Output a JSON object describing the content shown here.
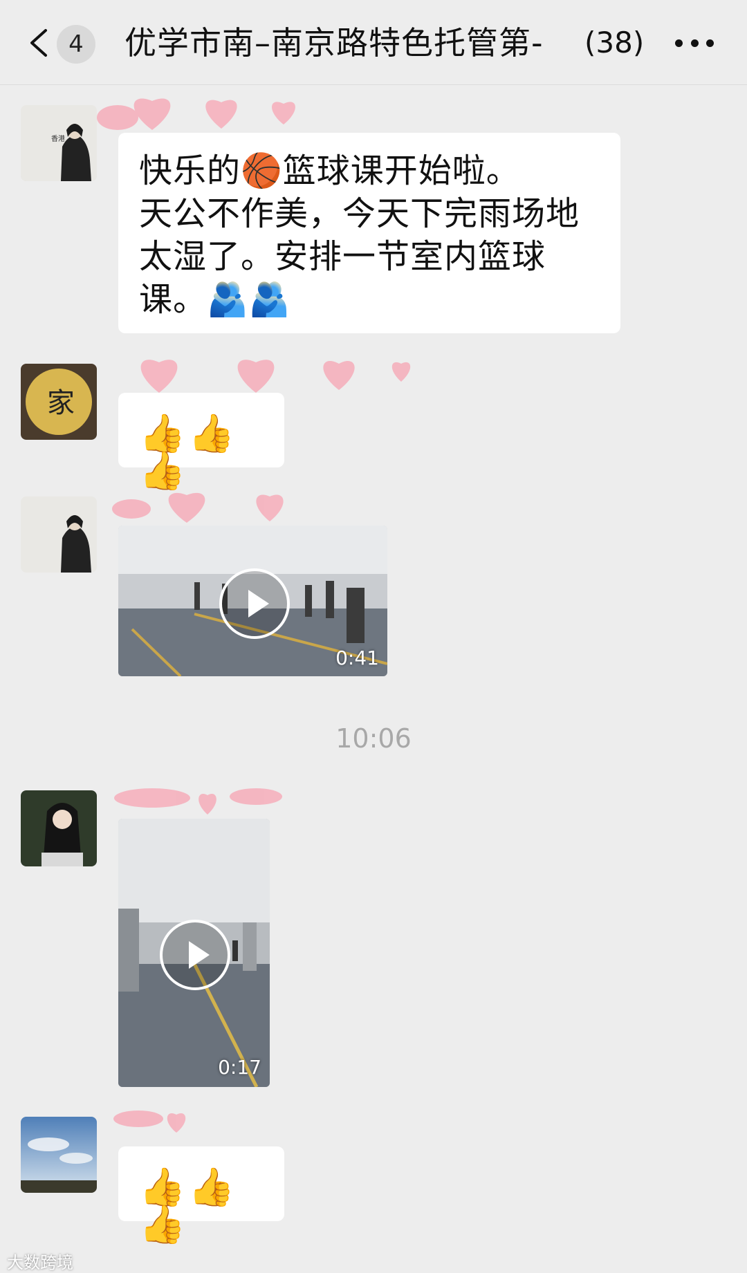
{
  "header": {
    "unread_count": "4",
    "title": "优学市南–南京路特色托管第-",
    "member_count": "(38)"
  },
  "messages": [
    {
      "type": "text",
      "text": "快乐的🏀篮球课开始啦。\n天公不作美，今天下完雨场地\n太湿了。安排一节室内篮球\n课。🫂🫂"
    },
    {
      "type": "emoji",
      "text": "👍👍👍"
    },
    {
      "type": "video",
      "duration": "0:41"
    },
    {
      "type": "video",
      "duration": "0:17"
    },
    {
      "type": "emoji",
      "text": "👍👍👍"
    }
  ],
  "timestamp": "10:06",
  "avatars": {
    "a1_caption": "香港",
    "a2_caption": "家"
  },
  "watermark": "大数跨境",
  "colors": {
    "background": "#ededed",
    "bubble": "#ffffff",
    "timestamp": "#a8a8a8"
  }
}
